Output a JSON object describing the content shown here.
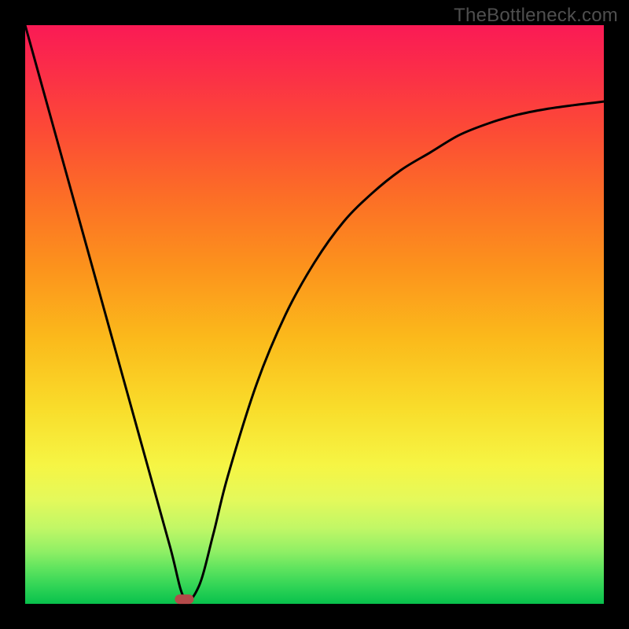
{
  "watermark": "TheBottleneck.com",
  "chart_data": {
    "type": "line",
    "title": "",
    "xlabel": "",
    "ylabel": "",
    "xlim": [
      0,
      100
    ],
    "ylim": [
      0,
      100
    ],
    "grid": false,
    "series": [
      {
        "name": "bottleneck-curve",
        "x": [
          0,
          5,
          10,
          15,
          20,
          25,
          27.5,
          30,
          32.5,
          35,
          40,
          45,
          50,
          55,
          60,
          65,
          70,
          75,
          80,
          85,
          90,
          95,
          100
        ],
        "values": [
          100,
          82,
          64,
          46,
          28,
          10,
          1,
          3,
          12,
          22,
          38,
          50,
          59,
          66,
          71,
          75,
          78,
          81,
          83,
          84.5,
          85.5,
          86.2,
          86.8
        ]
      }
    ],
    "marker": {
      "x": 27.5,
      "y": 0.8,
      "label": "optimal-point"
    },
    "background_gradient": {
      "top": "#fa1a55",
      "bottom": "#08c14c",
      "meaning": "red-high-bottleneck-to-green-low-bottleneck"
    }
  }
}
